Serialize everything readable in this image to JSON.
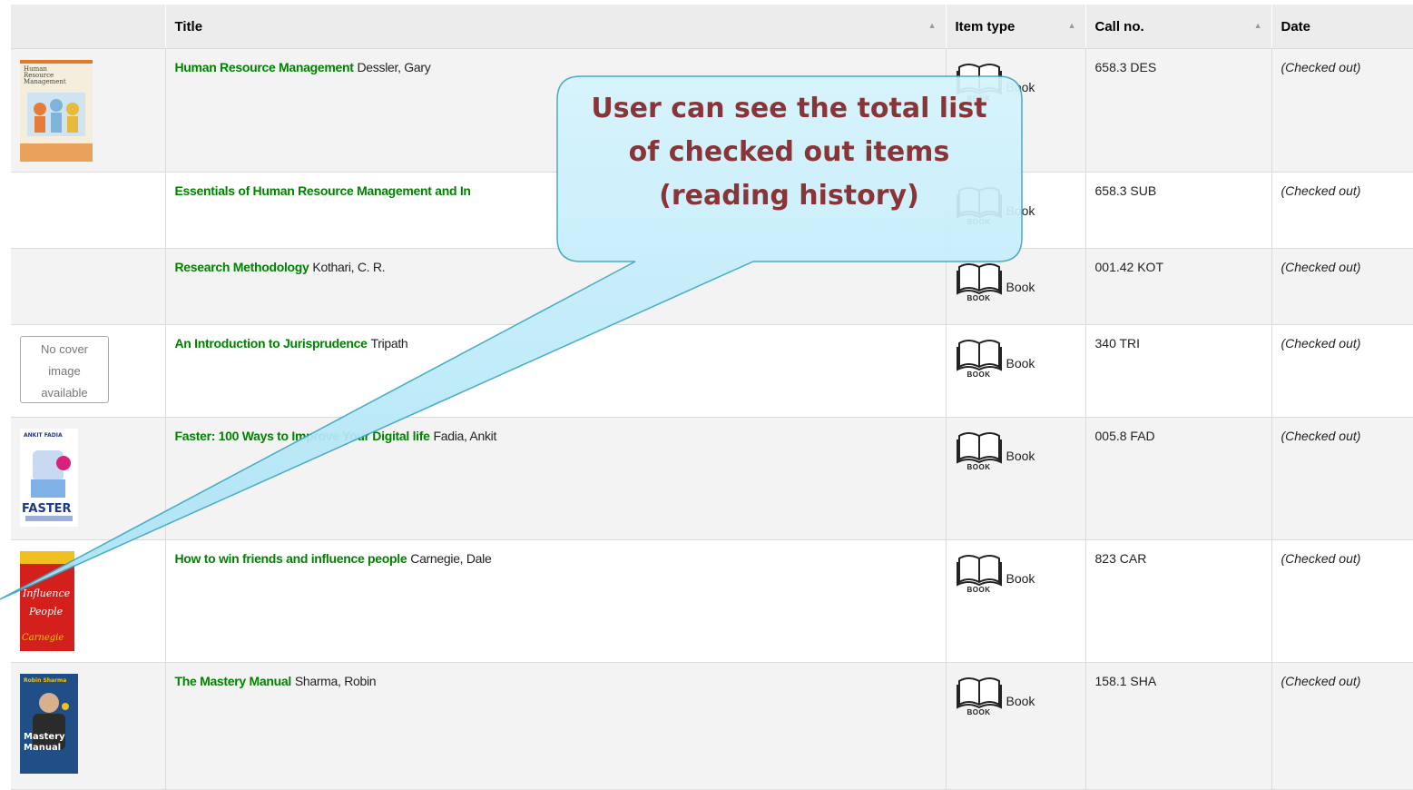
{
  "headers": {
    "cover": "",
    "title": "Title",
    "item_type": "Item type",
    "call_no": "Call no.",
    "date": "Date"
  },
  "icon_caption": "BOOK",
  "rows": [
    {
      "title": "Human Resource Management",
      "author": "Dessler, Gary",
      "item_type": "Book",
      "call_no": "658.3 DES",
      "date": "(Checked out)"
    },
    {
      "title": "Essentials of Human Resource Management and In",
      "author": "",
      "item_type": "Book",
      "call_no": "658.3 SUB",
      "date": "(Checked out)"
    },
    {
      "title": "Research Methodology",
      "author": "Kothari, C. R.",
      "item_type": "Book",
      "call_no": "001.42 KOT",
      "date": "(Checked out)"
    },
    {
      "title": "An Introduction to Jurisprudence",
      "author": "Tripath",
      "item_type": "Book",
      "call_no": "340 TRI",
      "date": "(Checked out)"
    },
    {
      "title": "Faster: 100 Ways to Improve Your Digital life",
      "author": "Fadia, Ankit",
      "item_type": "Book",
      "call_no": "005.8 FAD",
      "date": "(Checked out)"
    },
    {
      "title": "How to win friends and influence people",
      "author": "Carnegie, Dale",
      "item_type": "Book",
      "call_no": "823 CAR",
      "date": "(Checked out)"
    },
    {
      "title": "The Mastery Manual",
      "author": "Sharma, Robin",
      "item_type": "Book",
      "call_no": "158.1 SHA",
      "date": "(Checked out)"
    }
  ],
  "covers": {
    "hrm": {
      "lines": [
        "Human",
        "Resource",
        "Management"
      ]
    },
    "nocover": {
      "lines": [
        "No cover",
        "image",
        "available"
      ]
    },
    "faster": {
      "author": "ANKIT FADIA",
      "title": "FASTER"
    },
    "carnegie": {
      "lines": [
        "Influence",
        "People",
        "Carnegie"
      ]
    },
    "mastery": {
      "author": "Robin Sharma",
      "lines": [
        "Mastery",
        "Manual"
      ]
    }
  },
  "callout": {
    "lines": [
      "User can see the total list",
      "of checked out items",
      "(reading history)"
    ]
  }
}
